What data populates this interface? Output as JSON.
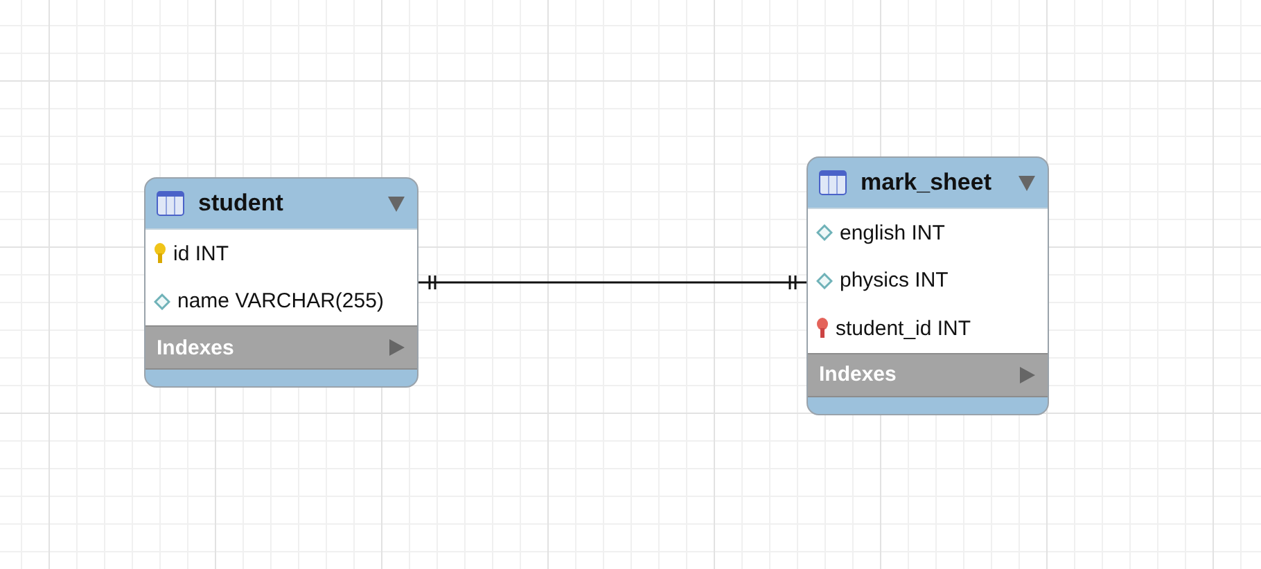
{
  "tables": [
    {
      "name": "student",
      "expanded": true,
      "columns": [
        {
          "kind": "primary_key",
          "label": "id INT"
        },
        {
          "kind": "attribute",
          "label": "name VARCHAR(255)"
        }
      ],
      "indexes": {
        "label": "Indexes",
        "expanded": false
      }
    },
    {
      "name": "mark_sheet",
      "expanded": true,
      "columns": [
        {
          "kind": "attribute",
          "label": "english INT"
        },
        {
          "kind": "attribute",
          "label": "physics INT"
        },
        {
          "kind": "foreign_key",
          "label": "student_id INT"
        }
      ],
      "indexes": {
        "label": "Indexes",
        "expanded": false
      }
    }
  ],
  "relationships": [
    {
      "kind": "one_to_one"
    }
  ]
}
